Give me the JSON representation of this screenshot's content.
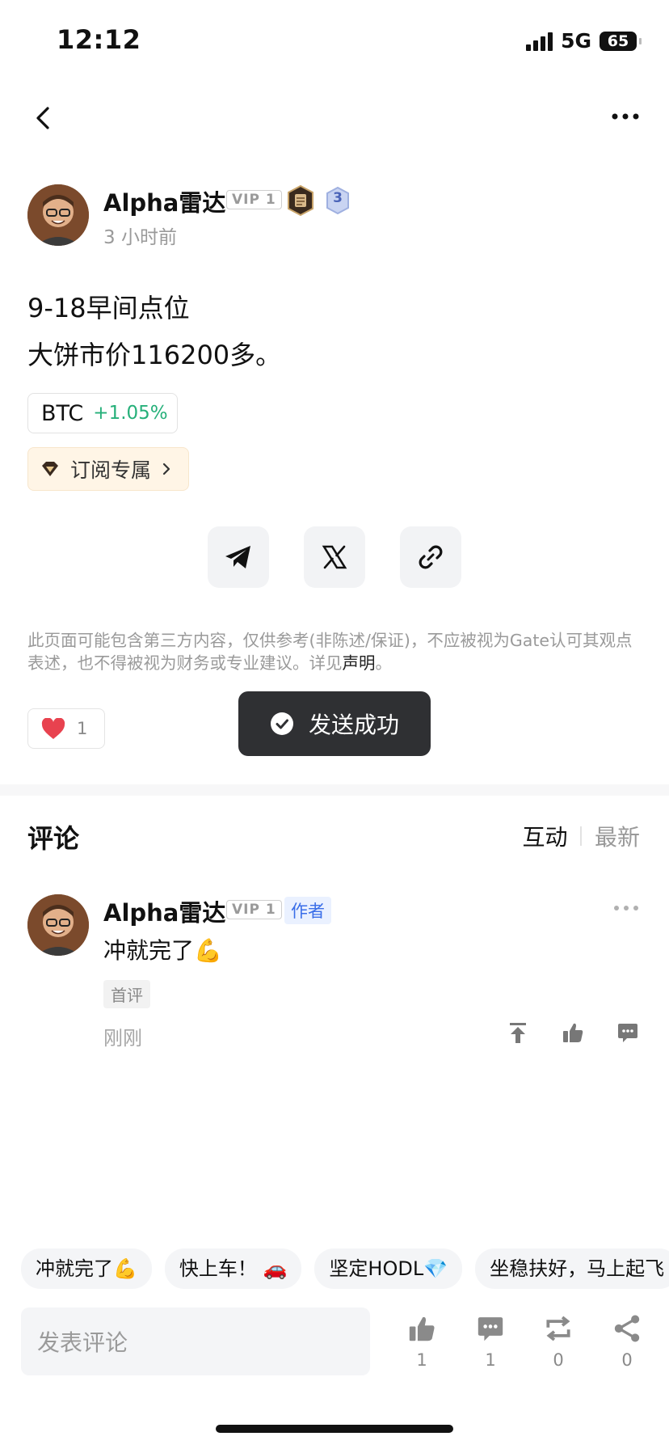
{
  "status_bar": {
    "time": "12:12",
    "network": "5G",
    "battery": "65"
  },
  "post": {
    "author": {
      "name": "Alpha雷达",
      "vip": "VIP 1",
      "level": "3",
      "time": "3 小时前"
    },
    "lines": [
      "9-18早间点位",
      "大饼市价116200多。"
    ],
    "coin": {
      "symbol": "BTC",
      "change": "+1.05%",
      "change_color": "#26b07a"
    },
    "subscribe_label": "订阅专属",
    "share": [
      "telegram-icon",
      "x-icon",
      "link-icon"
    ],
    "disclaimer_text": "此页面可能包含第三方内容，仅供参考(非陈述/保证)，不应被视为Gate认可其观点表述，也不得被视为财务或专业建议。详见",
    "disclaimer_link": "声明",
    "disclaimer_end": "。",
    "likes": "1"
  },
  "toast": {
    "text": "发送成功"
  },
  "comments": {
    "title": "评论",
    "sort_active": "互动",
    "sort_inactive": "最新",
    "items": [
      {
        "name": "Alpha雷达",
        "vip": "VIP 1",
        "badge": "作者",
        "text": "冲就完了💪",
        "tag": "首评",
        "time": "刚刚"
      }
    ]
  },
  "quick_replies": [
    "冲就完了💪",
    "快上车！ 🚗",
    "坚定HODL💎",
    "坐稳扶好，马上起飞"
  ],
  "bottom_bar": {
    "input_placeholder": "发表评论",
    "like_count": "1",
    "comment_count": "1",
    "repost_count": "0",
    "share_count": "0"
  },
  "colors": {
    "accent_green": "#26b07a",
    "toast_bg": "#2f3033",
    "author_badge": "#3a6ee8",
    "heart": "#e8424f"
  }
}
